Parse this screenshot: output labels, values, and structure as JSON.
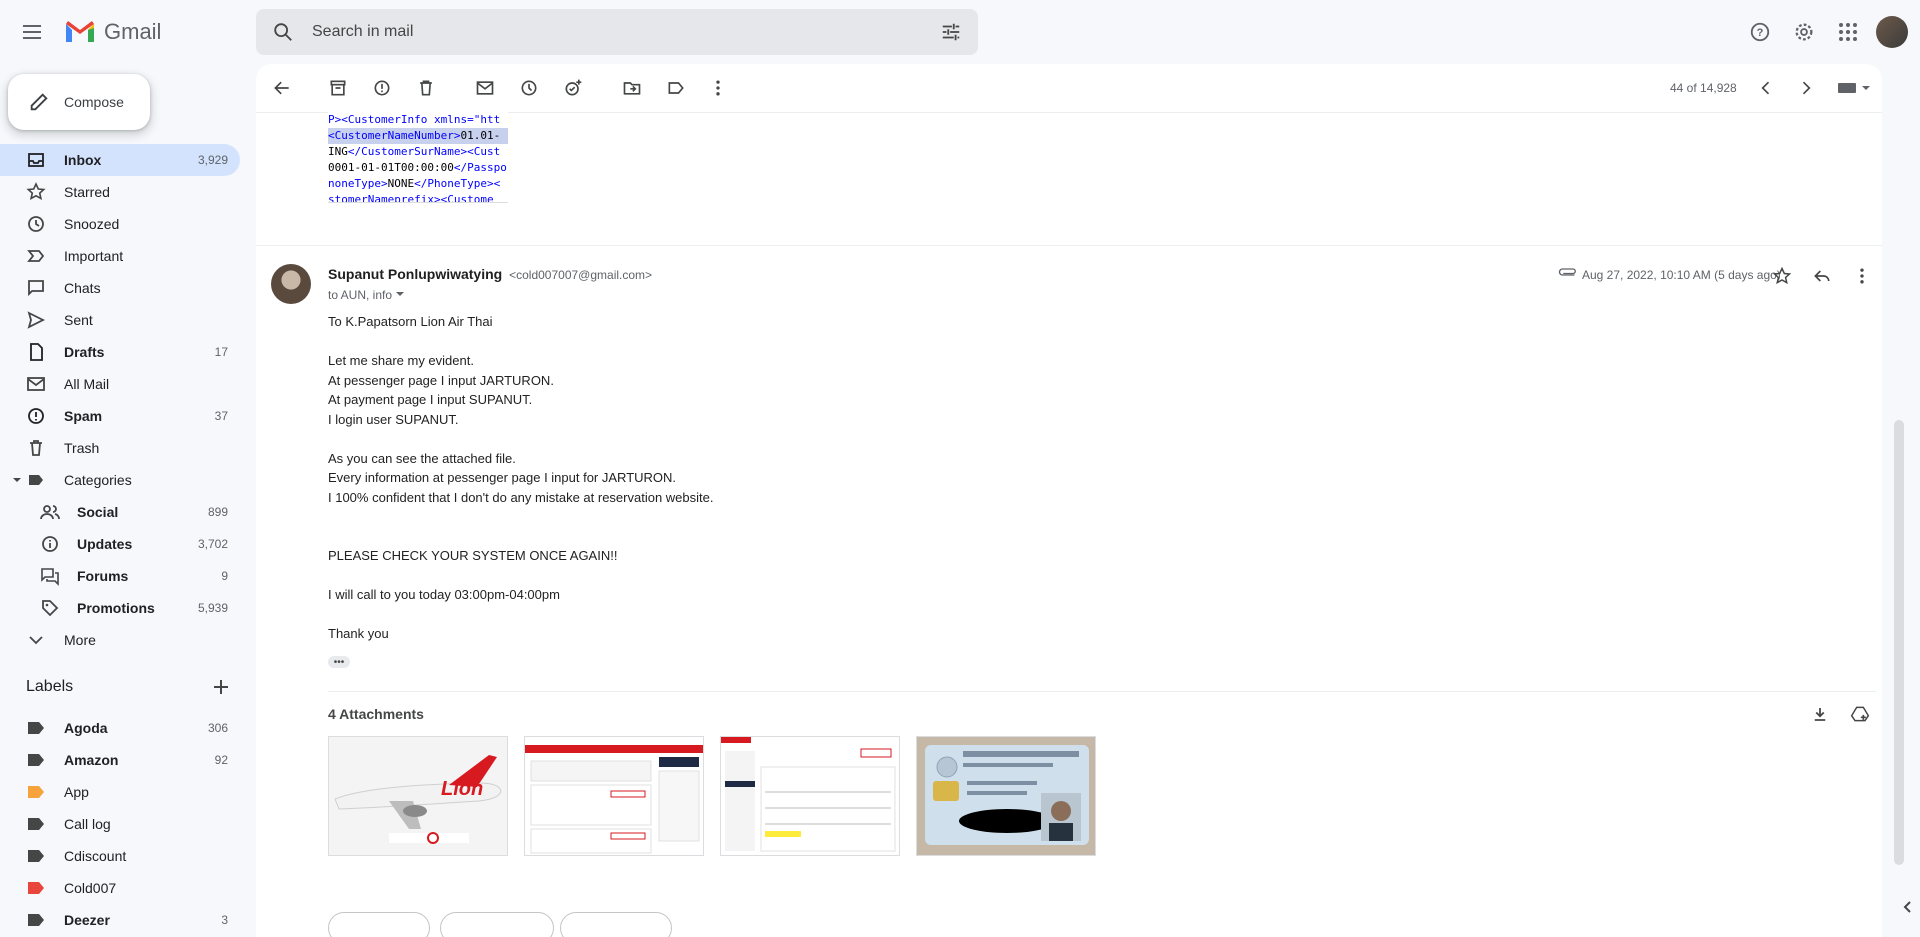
{
  "app": {
    "name": "Gmail"
  },
  "search": {
    "placeholder": "Search in mail"
  },
  "compose": {
    "label": "Compose"
  },
  "nav": [
    {
      "label": "Inbox",
      "count": "3,929",
      "bold": true,
      "active": true,
      "icon": "inbox-icon"
    },
    {
      "label": "Starred",
      "count": "",
      "icon": "star-icon"
    },
    {
      "label": "Snoozed",
      "count": "",
      "icon": "clock-icon"
    },
    {
      "label": "Important",
      "count": "",
      "icon": "important-icon"
    },
    {
      "label": "Chats",
      "count": "",
      "icon": "chat-icon"
    },
    {
      "label": "Sent",
      "count": "",
      "icon": "send-icon"
    },
    {
      "label": "Drafts",
      "count": "17",
      "bold": true,
      "icon": "draft-icon"
    },
    {
      "label": "All Mail",
      "count": "",
      "icon": "mail-icon"
    },
    {
      "label": "Spam",
      "count": "37",
      "bold": true,
      "icon": "spam-icon"
    },
    {
      "label": "Trash",
      "count": "",
      "icon": "trash-icon"
    },
    {
      "label": "Categories",
      "count": "",
      "icon": "label-icon"
    },
    {
      "label": "Social",
      "count": "899",
      "bold": true,
      "sub": true,
      "icon": "people-icon"
    },
    {
      "label": "Updates",
      "count": "3,702",
      "bold": true,
      "sub": true,
      "icon": "info-icon"
    },
    {
      "label": "Forums",
      "count": "9",
      "bold": true,
      "sub": true,
      "icon": "forum-icon"
    },
    {
      "label": "Promotions",
      "count": "5,939",
      "bold": true,
      "sub": true,
      "icon": "tag-icon"
    },
    {
      "label": "More",
      "count": "",
      "icon": "chevron-down-icon"
    }
  ],
  "labels": {
    "title": "Labels",
    "items": [
      {
        "label": "Agoda",
        "count": "306",
        "bold": true,
        "color": "#444746"
      },
      {
        "label": "Amazon",
        "count": "92",
        "bold": true,
        "color": "#444746"
      },
      {
        "label": "App",
        "count": "",
        "bold": false,
        "color": "#f6a33b"
      },
      {
        "label": "Call log",
        "count": "",
        "bold": false,
        "color": "#444746"
      },
      {
        "label": "Cdiscount",
        "count": "",
        "bold": false,
        "color": "#444746"
      },
      {
        "label": "Cold007",
        "count": "",
        "bold": false,
        "color": "#e8453c"
      },
      {
        "label": "Deezer",
        "count": "3",
        "bold": true,
        "color": "#444746"
      }
    ]
  },
  "toolbar": {
    "pager": "44 of 14,928"
  },
  "code_snippet": [
    [
      "tg",
      "P><CustomerInfo xmlns=\"htt"
    ],
    [
      "tg",
      "<CustomerNameNumber>",
      "txtblk",
      "01.01-"
    ],
    [
      "txtblk",
      "ING",
      "tg",
      "</CustomerSurName><Cust"
    ],
    [
      "txtblk",
      "0001-01-01T00:00:00",
      "tg",
      "</Passpo"
    ],
    [
      "tg",
      "noneType>",
      "txtblk",
      "NONE",
      "tg",
      "</PhoneType><"
    ],
    [
      "tg",
      "stomerNameprefix><Custome"
    ]
  ],
  "message": {
    "sender_name": "Supanut Ponlupwiwatying",
    "sender_email": "<cold007007@gmail.com>",
    "to": "to AUN, info",
    "date": "Aug 27, 2022, 10:10 AM (5 days ago)",
    "body": [
      "To K.Papatsorn Lion Air Thai",
      "",
      "Let me share my evident.",
      "At pessenger page I input JARTURON.",
      "At payment page I input SUPANUT.",
      "I login user SUPANUT.",
      "",
      "As you can see the attached file.",
      "Every information at pessenger page I input for JARTURON.",
      "I 100% confident that I don't do any mistake at reservation website.",
      "",
      "",
      "PLEASE CHECK YOUR SYSTEM ONCE AGAIN!!",
      "",
      "I will call to you today 03:00pm-04:00pm",
      "",
      "Thank you"
    ]
  },
  "attachments": {
    "title": "4 Attachments",
    "items": [
      {
        "kind": "airplane-photo",
        "caption": "Lion"
      },
      {
        "kind": "booking-screenshot"
      },
      {
        "kind": "payment-screenshot"
      },
      {
        "kind": "id-card-photo"
      }
    ]
  }
}
